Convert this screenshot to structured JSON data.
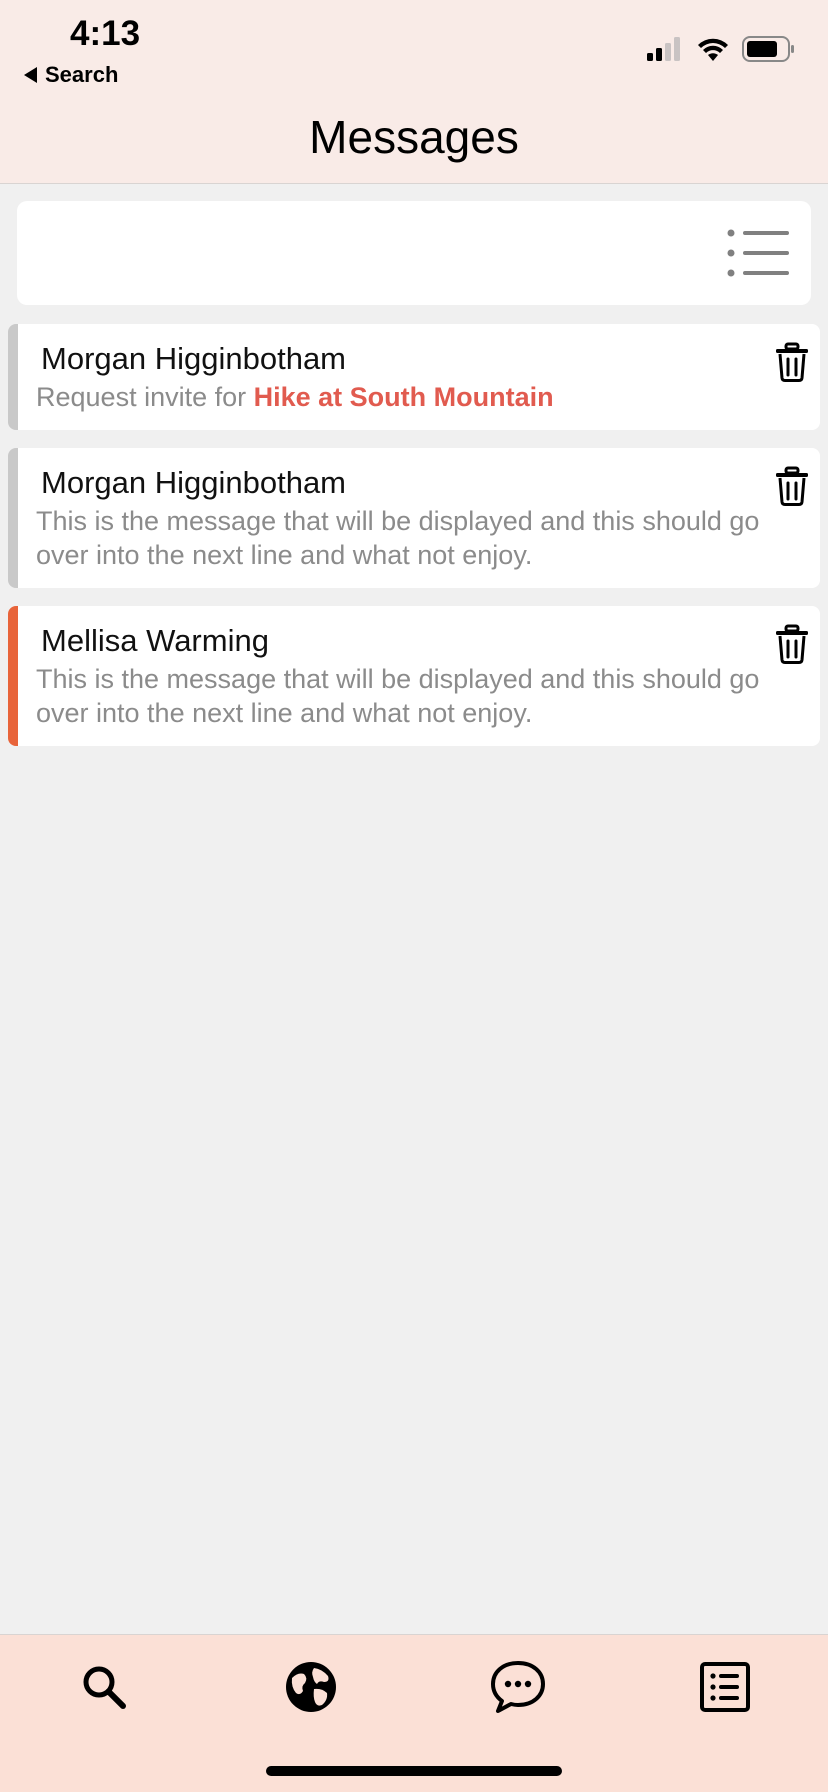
{
  "status_bar": {
    "time": "4:13",
    "back_label": "Search"
  },
  "header": {
    "title": "Messages"
  },
  "filter": {
    "icon": "list-icon"
  },
  "messages": [
    {
      "sender": "Morgan Higginbotham",
      "prefix": "Request invite for ",
      "highlight": "Hike at South Mountain",
      "text": "",
      "unread": false
    },
    {
      "sender": "Morgan Higginbotham",
      "prefix": "",
      "highlight": "",
      "text": "This is the message that will be displayed and this should go over into the next line and what not enjoy.",
      "unread": false
    },
    {
      "sender": "Mellisa Warming",
      "prefix": "",
      "highlight": "",
      "text": "This is the message that will be displayed and this should go over into the next line and what not enjoy.",
      "unread": true
    }
  ],
  "tabbar": {
    "tabs": [
      "search-icon",
      "globe-icon",
      "chat-bubble-icon",
      "list-document-icon"
    ]
  },
  "colors": {
    "header_bg": "#f9ebe7",
    "tabbar_bg": "#fbe0d6",
    "unread_accent": "#e8643a",
    "read_accent": "#c9c9c9",
    "highlight": "#e15b4f"
  }
}
